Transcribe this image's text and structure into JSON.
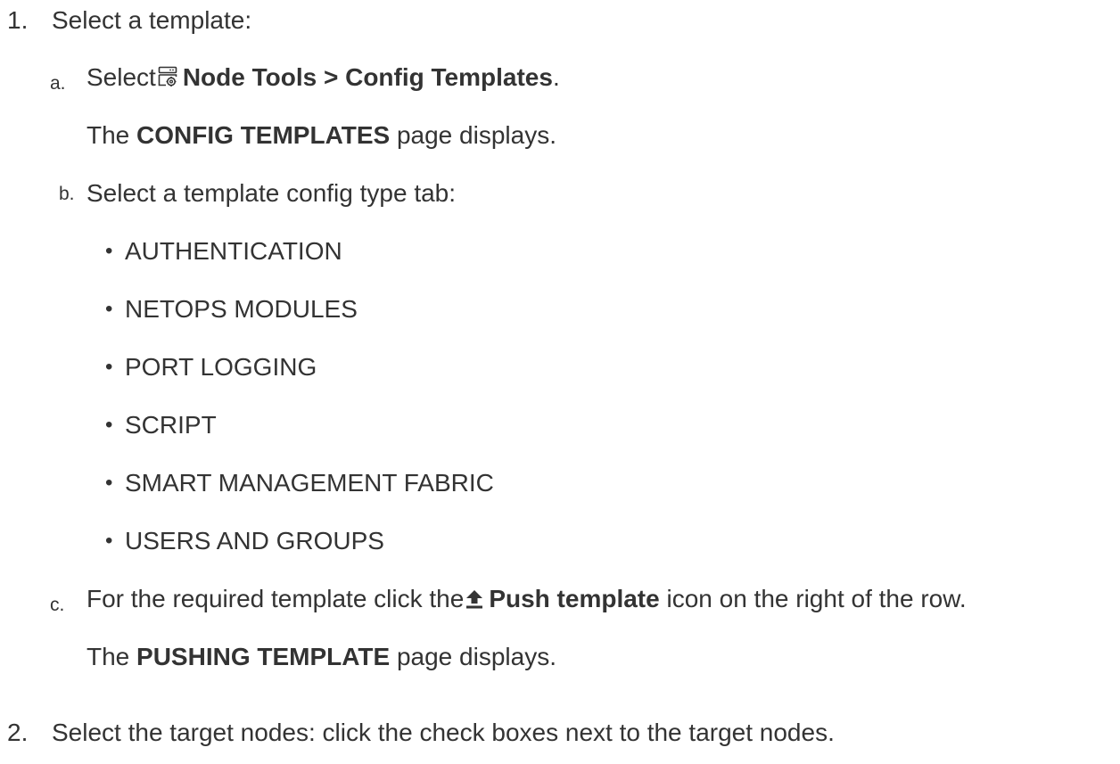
{
  "steps": [
    {
      "marker": "1.",
      "text": "Select a template:",
      "substeps": [
        {
          "marker": "a.",
          "prefix": "Select",
          "icon": "node-tools-icon",
          "bold": "Node Tools > Config Templates",
          "suffix": ".",
          "result_prefix": "The",
          "result_bold": "CONFIG TEMPLATES",
          "result_suffix": "page displays."
        },
        {
          "marker": "b.",
          "text": "Select a template config type tab:",
          "bullets": [
            "AUTHENTICATION",
            "NETOPS MODULES",
            "PORT LOGGING",
            "SCRIPT",
            "SMART MANAGEMENT FABRIC",
            "USERS AND GROUPS"
          ]
        },
        {
          "marker": "c.",
          "prefix": "For the required template click the",
          "icon": "push-template-icon",
          "bold": "Push template",
          "suffix": "icon on the right of the row.",
          "result_prefix": "The",
          "result_bold": "PUSHING TEMPLATE",
          "result_suffix": "page displays."
        }
      ]
    },
    {
      "marker": "2.",
      "text": "Select the target nodes: click the check boxes next to the target nodes."
    }
  ],
  "colors": {
    "text": "#333333",
    "icon": "#333333"
  }
}
